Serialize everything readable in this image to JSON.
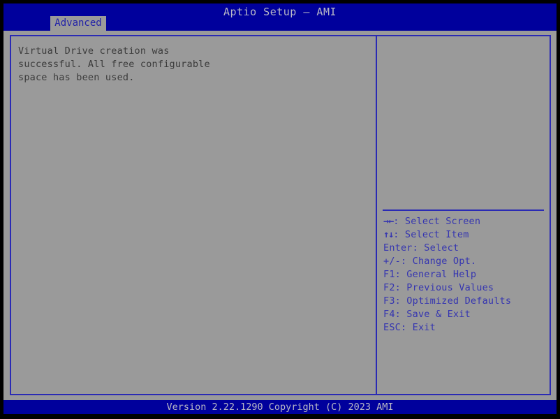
{
  "header": {
    "title": "Aptio Setup – AMI",
    "tab_label": "Advanced"
  },
  "main": {
    "message": "Virtual Drive creation was\nsuccessful. All free configurable\nspace has been used."
  },
  "help": {
    "items": [
      {
        "glyph": "→←",
        "text": ": Select Screen"
      },
      {
        "glyph": "↑↓",
        "text": ": Select Item"
      },
      {
        "glyph": "",
        "text": "Enter: Select"
      },
      {
        "glyph": "",
        "text": "+/-: Change Opt."
      },
      {
        "glyph": "",
        "text": "F1: General Help"
      },
      {
        "glyph": "",
        "text": "F2: Previous Values"
      },
      {
        "glyph": "",
        "text": "F3: Optimized Defaults"
      },
      {
        "glyph": "",
        "text": "F4: Save & Exit"
      },
      {
        "glyph": "",
        "text": "ESC: Exit"
      }
    ]
  },
  "footer": {
    "version": "Version 2.22.1290 Copyright (C) 2023 AMI"
  },
  "colors": {
    "header_blue": "#00009c",
    "body_gray": "#9a9a9a",
    "border_blue": "#2a2ab4",
    "help_text": "#3535b0",
    "title_text": "#b9b9c6",
    "message_text": "#3b3b3b",
    "outer_frame": "#000000"
  }
}
